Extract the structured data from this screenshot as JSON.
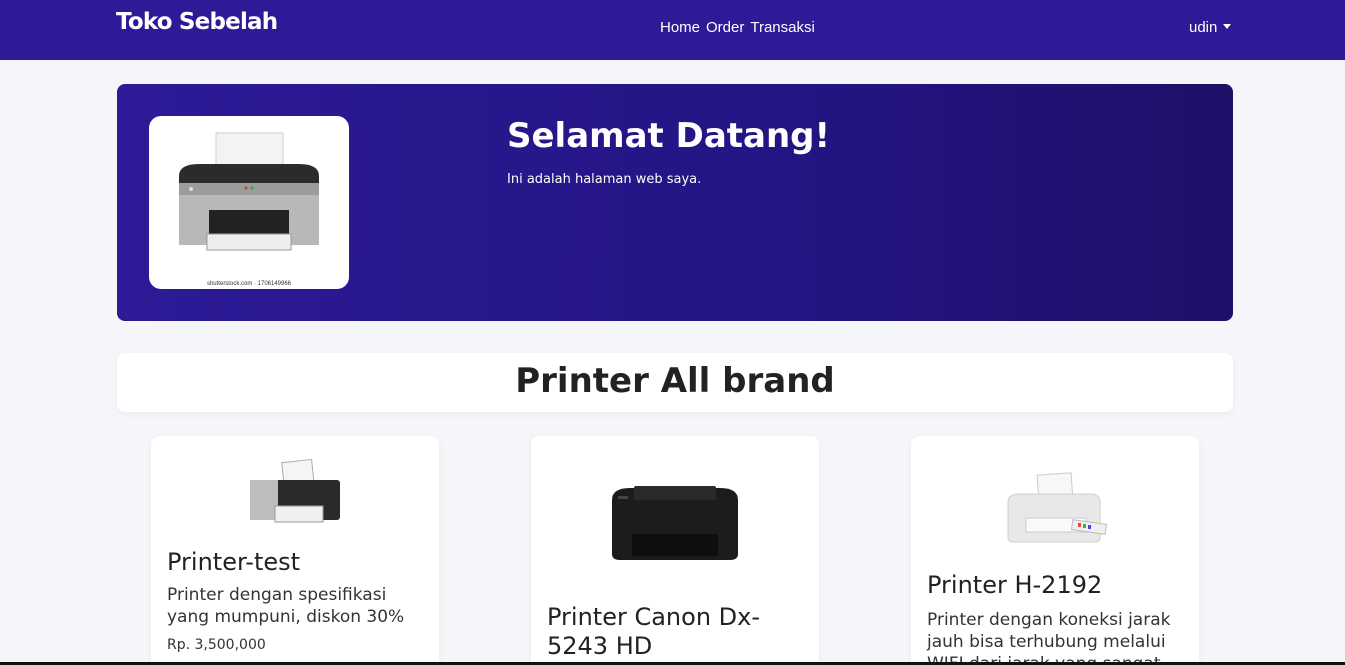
{
  "navbar": {
    "brand": "Toko Sebelah",
    "links": [
      "Home",
      "Order",
      "Transaksi"
    ],
    "user": "udin"
  },
  "hero": {
    "title": "Selamat Datang!",
    "subtitle": "Ini adalah halaman web saya.",
    "image_caption": "shutterstock.com · 1706149966"
  },
  "section": {
    "title": "Printer All brand"
  },
  "products": [
    {
      "name": "Printer-test",
      "description": "Printer dengan spesifikasi yang mumpuni, diskon 30%",
      "price": "Rp. 3,500,000"
    },
    {
      "name": "Printer Canon Dx-5243 HD",
      "description": "",
      "price": ""
    },
    {
      "name": "Printer H-2192",
      "description": "Printer dengan koneksi jarak jauh bisa terhubung melalui WIFI dari jarak yang sangat",
      "price": ""
    }
  ],
  "colors": {
    "navbar": "#2c1a97",
    "hero_start": "#2c1a97",
    "hero_end": "#1e1068",
    "background": "#f4f6f9"
  }
}
